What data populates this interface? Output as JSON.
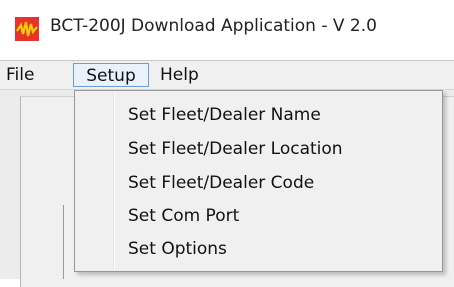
{
  "window": {
    "title": "BCT-200J Download Application - V 2.0",
    "icon": "app-logo-icon"
  },
  "menubar": {
    "file": "File",
    "setup": "Setup",
    "help": "Help"
  },
  "setup_menu": {
    "items": [
      "Set Fleet/Dealer Name",
      "Set Fleet/Dealer Location",
      "Set Fleet/Dealer Code",
      "Set Com Port",
      "Set Options"
    ]
  },
  "colors": {
    "icon_bg": "#e8332a",
    "icon_mark": "#f5d000",
    "menu_highlight": "#6c9ed4"
  }
}
